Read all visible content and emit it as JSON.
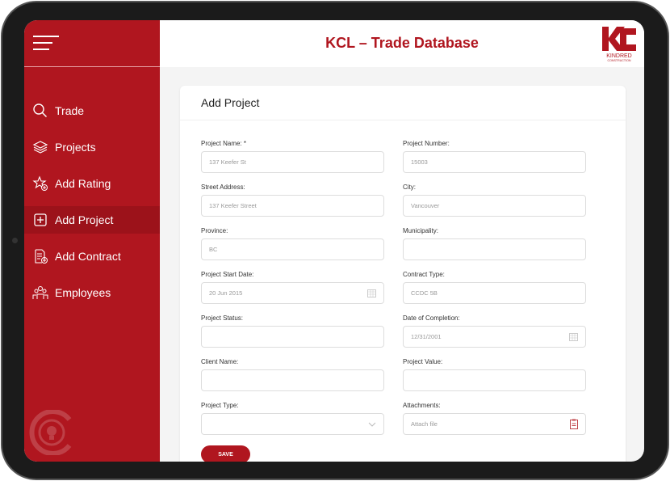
{
  "header": {
    "title": "KCL – Trade Database",
    "logo_text": "KINDRED CONSTRUCTION"
  },
  "sidebar": {
    "items": [
      {
        "label": "Trade",
        "icon": "search-icon"
      },
      {
        "label": "Projects",
        "icon": "layers-icon"
      },
      {
        "label": "Add Rating",
        "icon": "star-add-icon"
      },
      {
        "label": "Add Project",
        "icon": "plus-square-icon",
        "active": true
      },
      {
        "label": "Add Contract",
        "icon": "document-add-icon"
      },
      {
        "label": "Employees",
        "icon": "people-icon"
      }
    ]
  },
  "form": {
    "title": "Add Project",
    "save_label": "SAVE",
    "fields": [
      {
        "label": "Project Name: *",
        "value": "137 Keefer St"
      },
      {
        "label": "Project Number:",
        "value": "15003"
      },
      {
        "label": "Street Address:",
        "value": "137 Keefer Street"
      },
      {
        "label": "City:",
        "value": "Vancouver"
      },
      {
        "label": "Province:",
        "value": "BC"
      },
      {
        "label": "Municipality:",
        "value": ""
      },
      {
        "label": "Project Start Date:",
        "value": "20 Jun 2015",
        "icon": "calendar-icon"
      },
      {
        "label": "Contract Type:",
        "value": "CCDC 5B"
      },
      {
        "label": "Project Status:",
        "value": ""
      },
      {
        "label": "Date of Completion:",
        "value": "12/31/2001",
        "icon": "calendar-icon"
      },
      {
        "label": "Client Name:",
        "value": ""
      },
      {
        "label": "Project Value:",
        "value": ""
      },
      {
        "label": "Project Type:",
        "value": "",
        "icon": "chevron-down-icon"
      },
      {
        "label": "Attachments:",
        "value": "Attach file",
        "icon": "clipboard-icon"
      }
    ]
  },
  "colors": {
    "brand": "#b0161f"
  }
}
